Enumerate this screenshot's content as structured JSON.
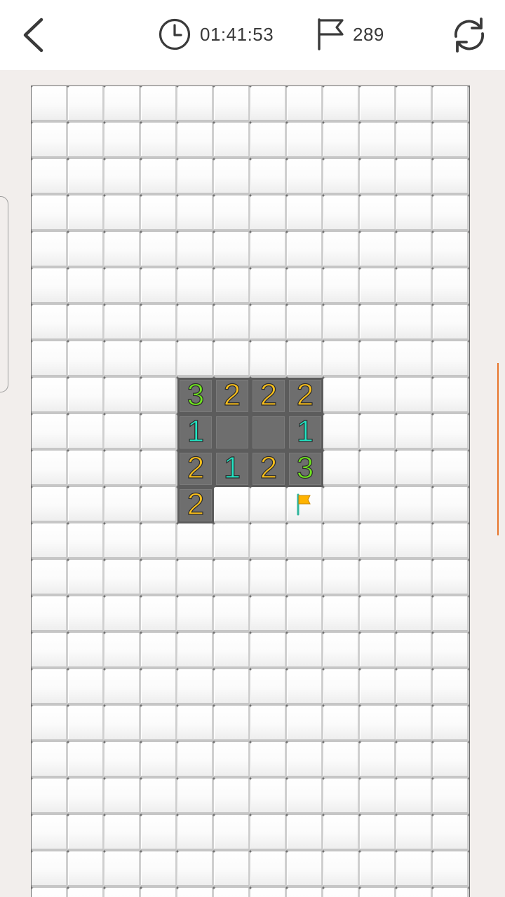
{
  "header": {
    "back_icon": "chevron-left-icon",
    "timer_icon": "clock-icon",
    "timer_text": "01:41:53",
    "flags_icon": "flag-outline-icon",
    "flags_remaining": "289",
    "restart_icon": "refresh-icon"
  },
  "board": {
    "columns": 12,
    "visible_rows": 23,
    "revealed_cells": [
      {
        "row": 8,
        "col": 4,
        "value": "3"
      },
      {
        "row": 8,
        "col": 5,
        "value": "2"
      },
      {
        "row": 8,
        "col": 6,
        "value": "2"
      },
      {
        "row": 8,
        "col": 7,
        "value": "2"
      },
      {
        "row": 9,
        "col": 4,
        "value": "1"
      },
      {
        "row": 9,
        "col": 5,
        "value": ""
      },
      {
        "row": 9,
        "col": 6,
        "value": ""
      },
      {
        "row": 9,
        "col": 7,
        "value": "1"
      },
      {
        "row": 10,
        "col": 4,
        "value": "2"
      },
      {
        "row": 10,
        "col": 5,
        "value": "1"
      },
      {
        "row": 10,
        "col": 6,
        "value": "2"
      },
      {
        "row": 10,
        "col": 7,
        "value": "3"
      },
      {
        "row": 11,
        "col": 4,
        "value": "2"
      }
    ],
    "flagged_cells": [
      {
        "row": 11,
        "col": 7
      }
    ],
    "number_colors": {
      "1": "#22e6c4",
      "2": "#ffc21a",
      "3": "#6fe61e"
    },
    "flag_color": "#ffb300",
    "flag_pole_color": "#2fb59c"
  },
  "scroll_indicator_color": "#e8742a"
}
